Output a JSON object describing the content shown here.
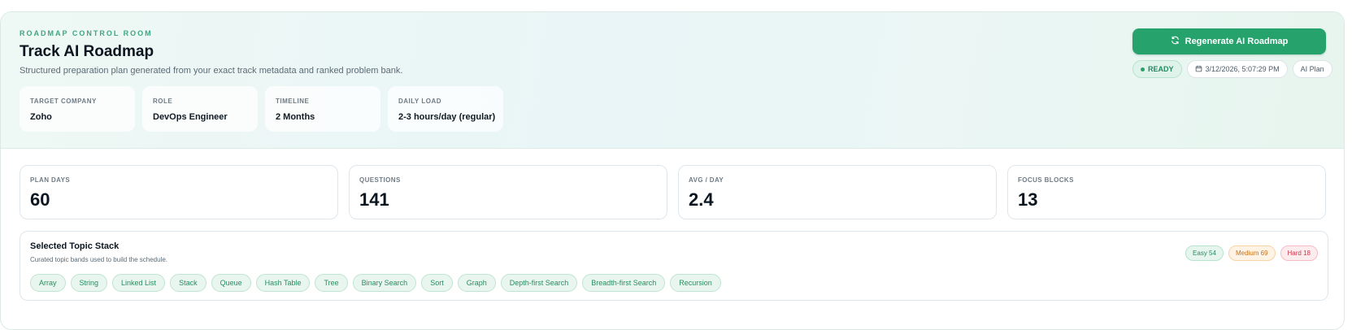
{
  "header": {
    "eyebrow": "ROADMAP CONTROL ROOM",
    "title": "Track AI Roadmap",
    "subtitle": "Structured preparation plan generated from your exact track metadata and ranked problem bank.",
    "regenerate_label": "Regenerate AI Roadmap",
    "status": "READY",
    "timestamp": "3/12/2026, 5:07:29 PM",
    "plan_type": "AI Plan",
    "accent_color": "#26a36d"
  },
  "meta": [
    {
      "label": "TARGET COMPANY",
      "value": "Zoho"
    },
    {
      "label": "ROLE",
      "value": "DevOps Engineer"
    },
    {
      "label": "TIMELINE",
      "value": "2 Months"
    },
    {
      "label": "DAILY LOAD",
      "value": "2-3 hours/day (regular)"
    }
  ],
  "stats": [
    {
      "label": "PLAN DAYS",
      "value": "60"
    },
    {
      "label": "QUESTIONS",
      "value": "141"
    },
    {
      "label": "AVG / DAY",
      "value": "2.4"
    },
    {
      "label": "FOCUS BLOCKS",
      "value": "13"
    }
  ],
  "topics": {
    "title": "Selected Topic Stack",
    "subtitle": "Curated topic bands used to build the schedule.",
    "chips": [
      "Array",
      "String",
      "Linked List",
      "Stack",
      "Queue",
      "Hash Table",
      "Tree",
      "Binary Search",
      "Sort",
      "Graph",
      "Depth-first Search",
      "Breadth-first Search",
      "Recursion"
    ],
    "difficulty": {
      "easy": "Easy 54",
      "medium": "Medium 69",
      "hard": "Hard 18"
    }
  },
  "icons": {
    "regenerate": "refresh-icon",
    "timestamp": "calendar-icon"
  }
}
